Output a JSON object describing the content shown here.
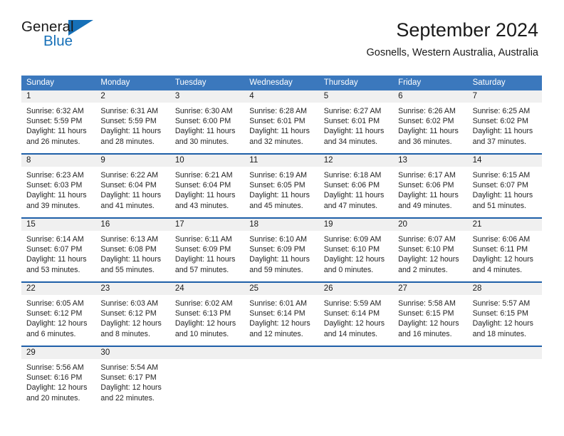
{
  "logo": {
    "word_top": "General",
    "word_bottom": "Blue",
    "accent_color": "#1670b8"
  },
  "header": {
    "title": "September 2024",
    "subtitle": "Gosnells, Western Australia, Australia",
    "header_bg_color": "#3b78bd",
    "week_divider_color": "#1f5fa8",
    "daynum_band_color": "#f0f0f0"
  },
  "weekdays": [
    "Sunday",
    "Monday",
    "Tuesday",
    "Wednesday",
    "Thursday",
    "Friday",
    "Saturday"
  ],
  "weeks": [
    {
      "days": [
        {
          "num": "1",
          "sunrise": "Sunrise: 6:32 AM",
          "sunset": "Sunset: 5:59 PM",
          "daylight_1": "Daylight: 11 hours",
          "daylight_2": "and 26 minutes."
        },
        {
          "num": "2",
          "sunrise": "Sunrise: 6:31 AM",
          "sunset": "Sunset: 5:59 PM",
          "daylight_1": "Daylight: 11 hours",
          "daylight_2": "and 28 minutes."
        },
        {
          "num": "3",
          "sunrise": "Sunrise: 6:30 AM",
          "sunset": "Sunset: 6:00 PM",
          "daylight_1": "Daylight: 11 hours",
          "daylight_2": "and 30 minutes."
        },
        {
          "num": "4",
          "sunrise": "Sunrise: 6:28 AM",
          "sunset": "Sunset: 6:01 PM",
          "daylight_1": "Daylight: 11 hours",
          "daylight_2": "and 32 minutes."
        },
        {
          "num": "5",
          "sunrise": "Sunrise: 6:27 AM",
          "sunset": "Sunset: 6:01 PM",
          "daylight_1": "Daylight: 11 hours",
          "daylight_2": "and 34 minutes."
        },
        {
          "num": "6",
          "sunrise": "Sunrise: 6:26 AM",
          "sunset": "Sunset: 6:02 PM",
          "daylight_1": "Daylight: 11 hours",
          "daylight_2": "and 36 minutes."
        },
        {
          "num": "7",
          "sunrise": "Sunrise: 6:25 AM",
          "sunset": "Sunset: 6:02 PM",
          "daylight_1": "Daylight: 11 hours",
          "daylight_2": "and 37 minutes."
        }
      ]
    },
    {
      "days": [
        {
          "num": "8",
          "sunrise": "Sunrise: 6:23 AM",
          "sunset": "Sunset: 6:03 PM",
          "daylight_1": "Daylight: 11 hours",
          "daylight_2": "and 39 minutes."
        },
        {
          "num": "9",
          "sunrise": "Sunrise: 6:22 AM",
          "sunset": "Sunset: 6:04 PM",
          "daylight_1": "Daylight: 11 hours",
          "daylight_2": "and 41 minutes."
        },
        {
          "num": "10",
          "sunrise": "Sunrise: 6:21 AM",
          "sunset": "Sunset: 6:04 PM",
          "daylight_1": "Daylight: 11 hours",
          "daylight_2": "and 43 minutes."
        },
        {
          "num": "11",
          "sunrise": "Sunrise: 6:19 AM",
          "sunset": "Sunset: 6:05 PM",
          "daylight_1": "Daylight: 11 hours",
          "daylight_2": "and 45 minutes."
        },
        {
          "num": "12",
          "sunrise": "Sunrise: 6:18 AM",
          "sunset": "Sunset: 6:06 PM",
          "daylight_1": "Daylight: 11 hours",
          "daylight_2": "and 47 minutes."
        },
        {
          "num": "13",
          "sunrise": "Sunrise: 6:17 AM",
          "sunset": "Sunset: 6:06 PM",
          "daylight_1": "Daylight: 11 hours",
          "daylight_2": "and 49 minutes."
        },
        {
          "num": "14",
          "sunrise": "Sunrise: 6:15 AM",
          "sunset": "Sunset: 6:07 PM",
          "daylight_1": "Daylight: 11 hours",
          "daylight_2": "and 51 minutes."
        }
      ]
    },
    {
      "days": [
        {
          "num": "15",
          "sunrise": "Sunrise: 6:14 AM",
          "sunset": "Sunset: 6:07 PM",
          "daylight_1": "Daylight: 11 hours",
          "daylight_2": "and 53 minutes."
        },
        {
          "num": "16",
          "sunrise": "Sunrise: 6:13 AM",
          "sunset": "Sunset: 6:08 PM",
          "daylight_1": "Daylight: 11 hours",
          "daylight_2": "and 55 minutes."
        },
        {
          "num": "17",
          "sunrise": "Sunrise: 6:11 AM",
          "sunset": "Sunset: 6:09 PM",
          "daylight_1": "Daylight: 11 hours",
          "daylight_2": "and 57 minutes."
        },
        {
          "num": "18",
          "sunrise": "Sunrise: 6:10 AM",
          "sunset": "Sunset: 6:09 PM",
          "daylight_1": "Daylight: 11 hours",
          "daylight_2": "and 59 minutes."
        },
        {
          "num": "19",
          "sunrise": "Sunrise: 6:09 AM",
          "sunset": "Sunset: 6:10 PM",
          "daylight_1": "Daylight: 12 hours",
          "daylight_2": "and 0 minutes."
        },
        {
          "num": "20",
          "sunrise": "Sunrise: 6:07 AM",
          "sunset": "Sunset: 6:10 PM",
          "daylight_1": "Daylight: 12 hours",
          "daylight_2": "and 2 minutes."
        },
        {
          "num": "21",
          "sunrise": "Sunrise: 6:06 AM",
          "sunset": "Sunset: 6:11 PM",
          "daylight_1": "Daylight: 12 hours",
          "daylight_2": "and 4 minutes."
        }
      ]
    },
    {
      "days": [
        {
          "num": "22",
          "sunrise": "Sunrise: 6:05 AM",
          "sunset": "Sunset: 6:12 PM",
          "daylight_1": "Daylight: 12 hours",
          "daylight_2": "and 6 minutes."
        },
        {
          "num": "23",
          "sunrise": "Sunrise: 6:03 AM",
          "sunset": "Sunset: 6:12 PM",
          "daylight_1": "Daylight: 12 hours",
          "daylight_2": "and 8 minutes."
        },
        {
          "num": "24",
          "sunrise": "Sunrise: 6:02 AM",
          "sunset": "Sunset: 6:13 PM",
          "daylight_1": "Daylight: 12 hours",
          "daylight_2": "and 10 minutes."
        },
        {
          "num": "25",
          "sunrise": "Sunrise: 6:01 AM",
          "sunset": "Sunset: 6:14 PM",
          "daylight_1": "Daylight: 12 hours",
          "daylight_2": "and 12 minutes."
        },
        {
          "num": "26",
          "sunrise": "Sunrise: 5:59 AM",
          "sunset": "Sunset: 6:14 PM",
          "daylight_1": "Daylight: 12 hours",
          "daylight_2": "and 14 minutes."
        },
        {
          "num": "27",
          "sunrise": "Sunrise: 5:58 AM",
          "sunset": "Sunset: 6:15 PM",
          "daylight_1": "Daylight: 12 hours",
          "daylight_2": "and 16 minutes."
        },
        {
          "num": "28",
          "sunrise": "Sunrise: 5:57 AM",
          "sunset": "Sunset: 6:15 PM",
          "daylight_1": "Daylight: 12 hours",
          "daylight_2": "and 18 minutes."
        }
      ]
    },
    {
      "days": [
        {
          "num": "29",
          "sunrise": "Sunrise: 5:56 AM",
          "sunset": "Sunset: 6:16 PM",
          "daylight_1": "Daylight: 12 hours",
          "daylight_2": "and 20 minutes."
        },
        {
          "num": "30",
          "sunrise": "Sunrise: 5:54 AM",
          "sunset": "Sunset: 6:17 PM",
          "daylight_1": "Daylight: 12 hours",
          "daylight_2": "and 22 minutes."
        },
        {
          "num": "",
          "sunrise": "",
          "sunset": "",
          "daylight_1": "",
          "daylight_2": ""
        },
        {
          "num": "",
          "sunrise": "",
          "sunset": "",
          "daylight_1": "",
          "daylight_2": ""
        },
        {
          "num": "",
          "sunrise": "",
          "sunset": "",
          "daylight_1": "",
          "daylight_2": ""
        },
        {
          "num": "",
          "sunrise": "",
          "sunset": "",
          "daylight_1": "",
          "daylight_2": ""
        },
        {
          "num": "",
          "sunrise": "",
          "sunset": "",
          "daylight_1": "",
          "daylight_2": ""
        }
      ]
    }
  ]
}
